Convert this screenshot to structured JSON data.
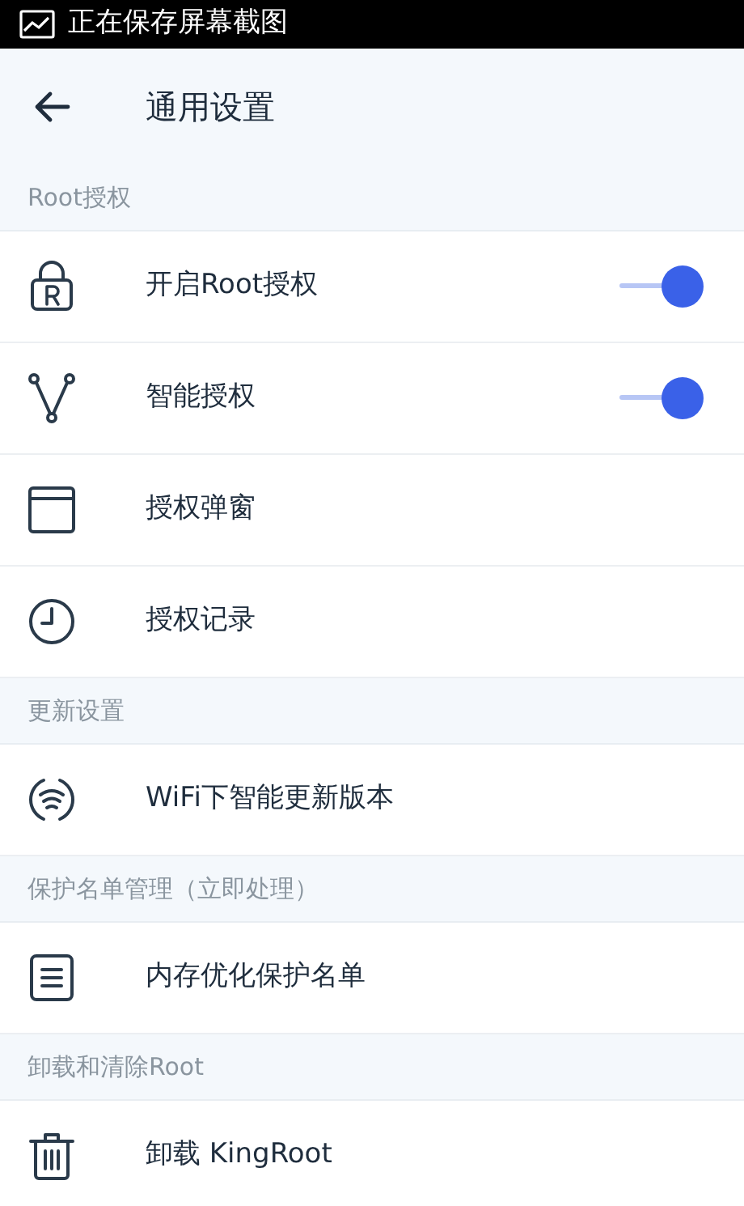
{
  "status_bar": {
    "text": "正在保存屏幕截图"
  },
  "header": {
    "title": "通用设置"
  },
  "sections": [
    {
      "title": "Root授权",
      "items": [
        {
          "label": "开启Root授权",
          "kind": "switch",
          "on": true
        },
        {
          "label": "智能授权",
          "kind": "switch",
          "on": true
        },
        {
          "label": "授权弹窗",
          "kind": "link"
        },
        {
          "label": "授权记录",
          "kind": "link"
        }
      ]
    },
    {
      "title": "更新设置",
      "items": [
        {
          "label": "WiFi下智能更新版本",
          "kind": "link"
        }
      ]
    },
    {
      "title": "保护名单管理（立即处理）",
      "items": [
        {
          "label": "内存优化保护名单",
          "kind": "link"
        }
      ]
    },
    {
      "title": "卸载和清除Root",
      "items": [
        {
          "label": "卸载 KingRoot",
          "kind": "link"
        }
      ]
    }
  ]
}
